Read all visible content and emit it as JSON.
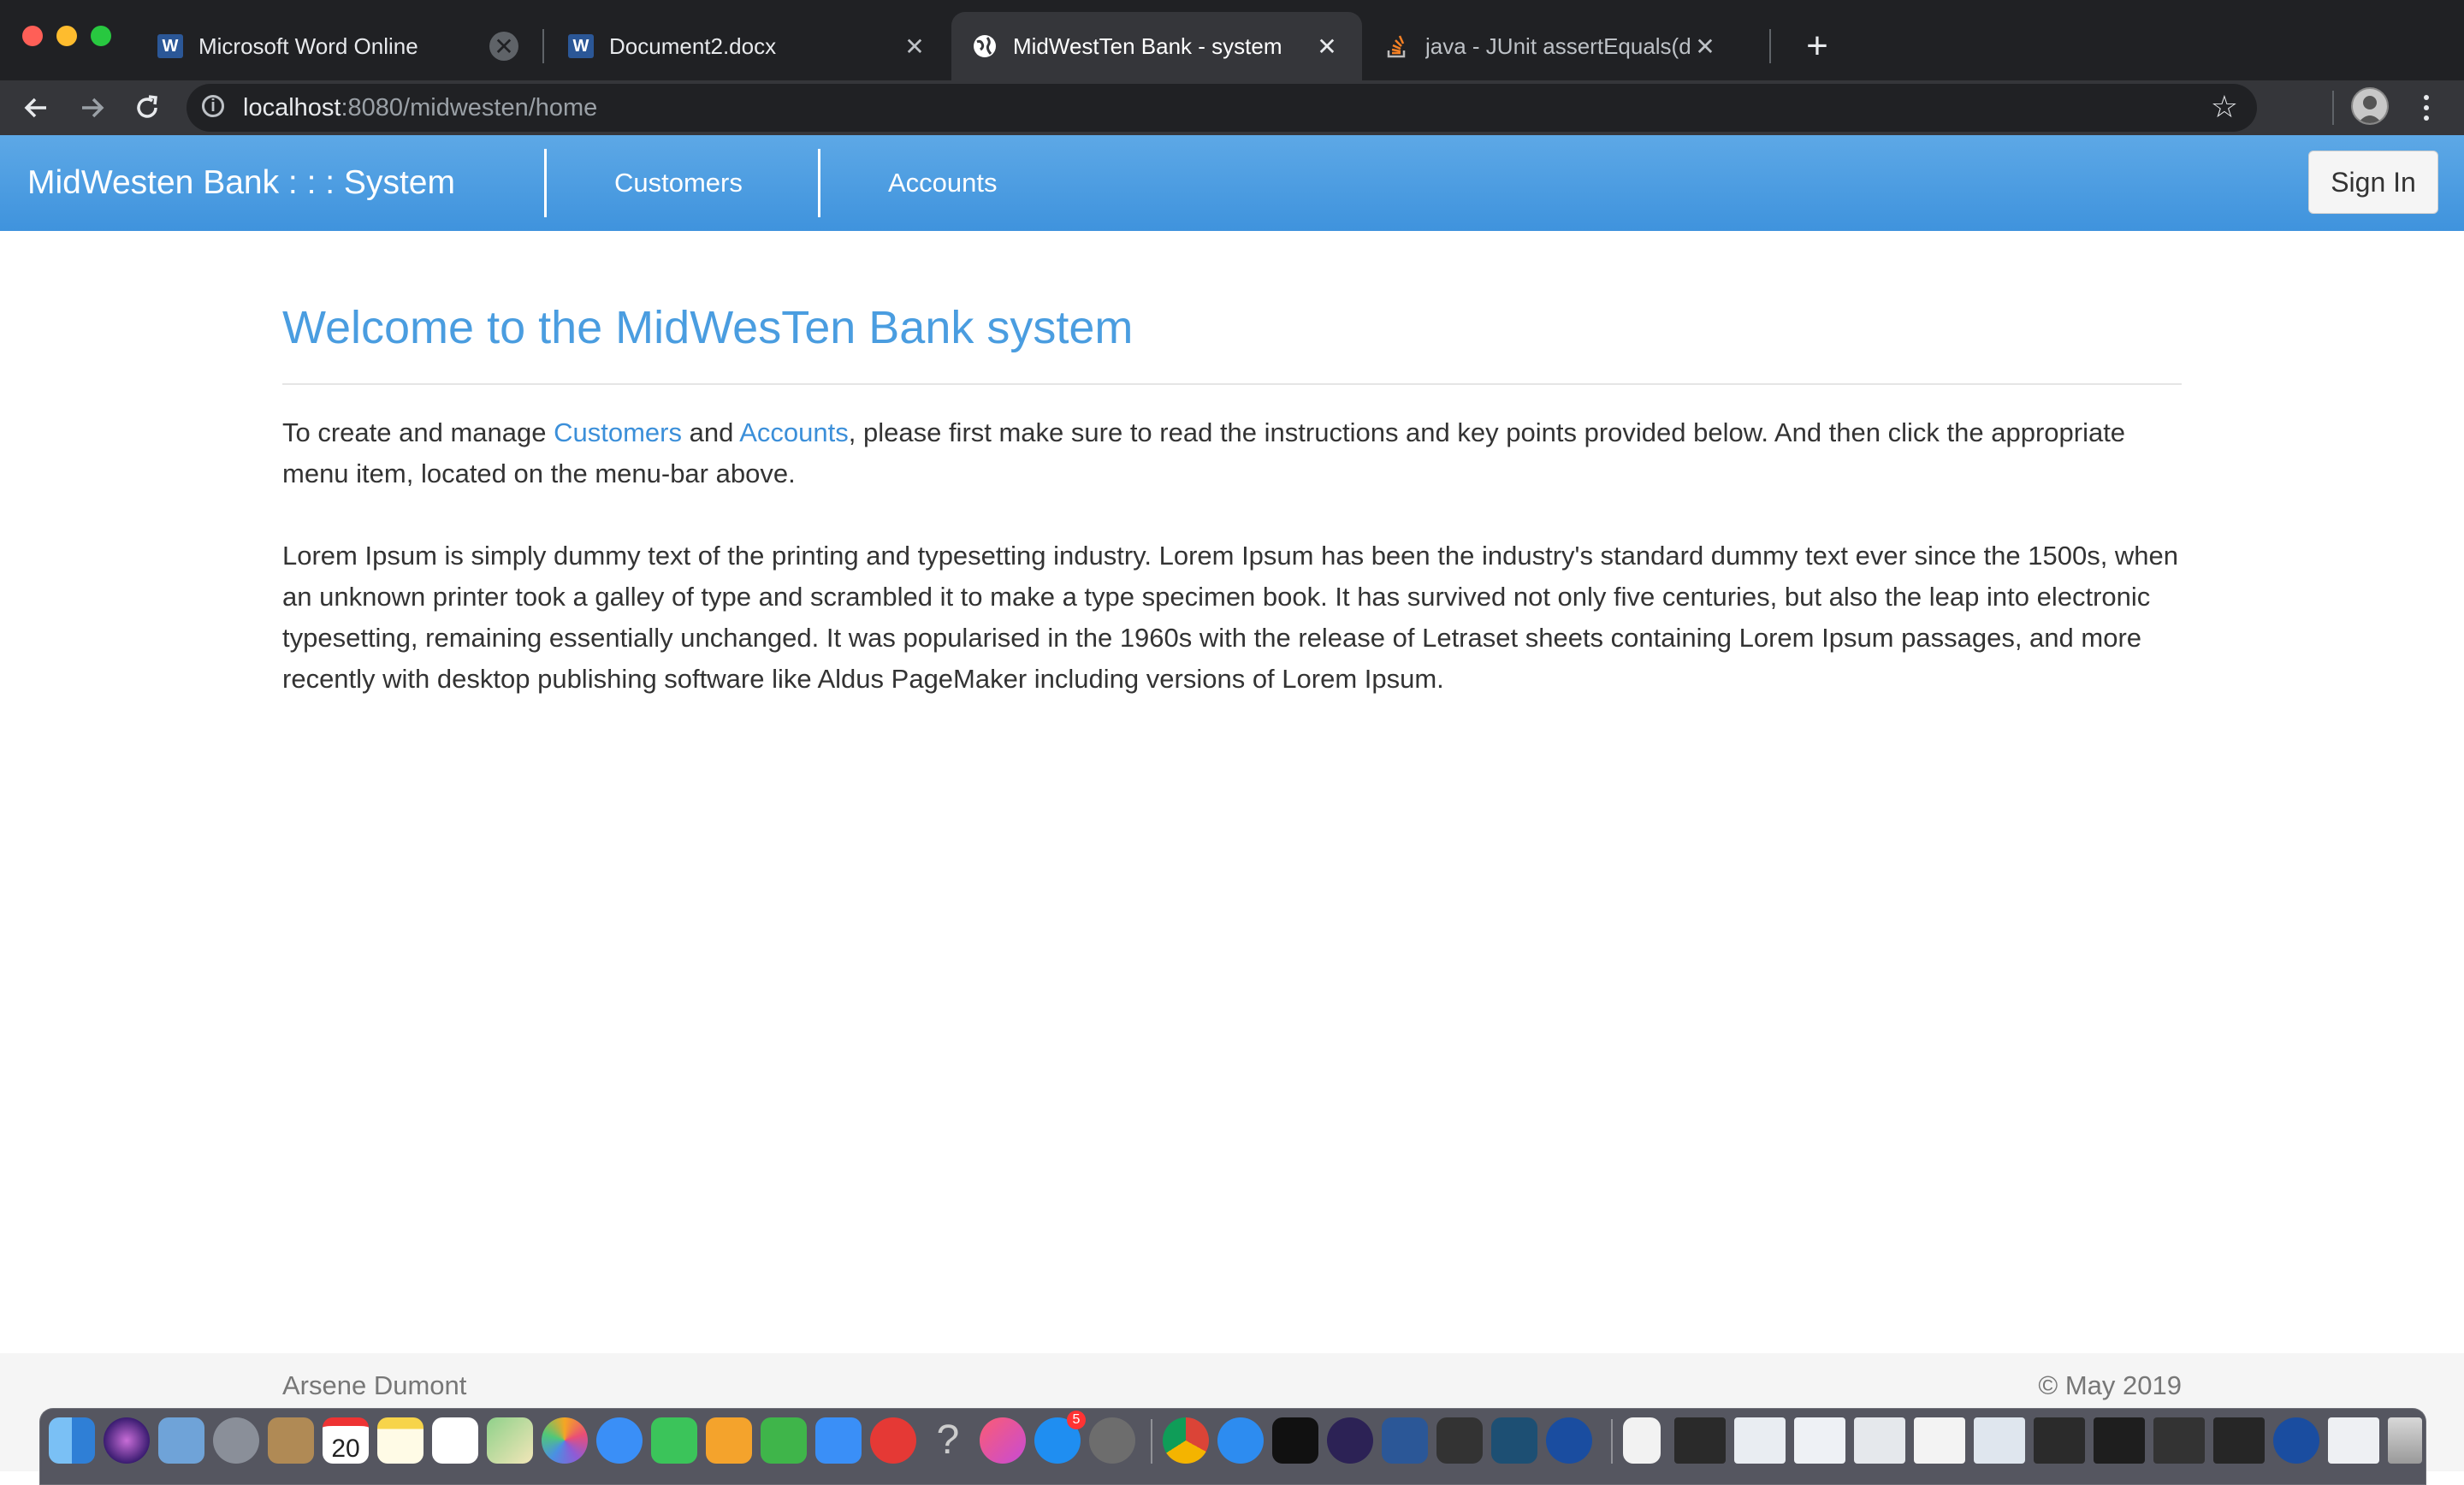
{
  "browser": {
    "tabs": [
      {
        "title": "Microsoft Word Online",
        "icon": "word-icon",
        "active": false
      },
      {
        "title": "Document2.docx",
        "icon": "word-icon",
        "active": false
      },
      {
        "title": "MidWestTen Bank - system",
        "icon": "globe-icon",
        "active": true
      },
      {
        "title": "java - JUnit assertEquals(doub",
        "icon": "stackoverflow-icon",
        "active": false
      }
    ],
    "new_tab_label": "+",
    "url": {
      "host": "localhost",
      "rest": ":8080/midwesten/home"
    },
    "close_glyph": "✕"
  },
  "navbar": {
    "brand": "MidWesten Bank : : : System",
    "links": [
      "Customers",
      "Accounts"
    ],
    "sign_in": "Sign In"
  },
  "main": {
    "title": "Welcome to the MidWesTen Bank system",
    "intro": {
      "before": "To create and manage ",
      "link1": "Customers",
      "middle": " and ",
      "link2": "Accounts",
      "after": ", please first make sure to read the instructions and key points provided below. And then click the appropriate menu item, located on the menu-bar above."
    },
    "lorem": "Lorem Ipsum is simply dummy text of the printing and typesetting industry. Lorem Ipsum has been the industry's standard dummy text ever since the 1500s, when an unknown printer took a galley of type and scrambled it to make a type specimen book. It has survived not only five centuries, but also the leap into electronic typesetting, remaining essentially unchanged. It was popularised in the 1960s with the release of Letraset sheets containing Lorem Ipsum passages, and more recently with desktop publishing software like Aldus PageMaker including versions of Lorem Ipsum."
  },
  "footer": {
    "author": "Arsene Dumont",
    "copyright": "© May 2019"
  },
  "dock": {
    "calendar_day": "20",
    "appstore_badge": "5",
    "apps": [
      "finder-icon",
      "siri-icon",
      "preview-icon",
      "launchpad-icon",
      "contacts-icon",
      "calendar-icon",
      "notes-icon",
      "reminders-icon",
      "maps-icon",
      "photos-icon",
      "messages-icon",
      "facetime-icon",
      "pages-icon",
      "numbers-icon",
      "keynote-icon",
      "no-entry-icon",
      "help-icon",
      "itunes-icon",
      "appstore-icon",
      "system-preferences-icon",
      "chrome-icon",
      "safari-icon",
      "intellij-icon",
      "eclipse-icon",
      "word-icon",
      "sublime-icon",
      "mysql-workbench-icon",
      "android-studio-icon",
      "file-icon",
      "window-thumbnail-icon",
      "trash-icon"
    ]
  },
  "colors": {
    "navbar": "#4a9de0",
    "title": "#4a9de0",
    "link": "#3b8fd9"
  }
}
